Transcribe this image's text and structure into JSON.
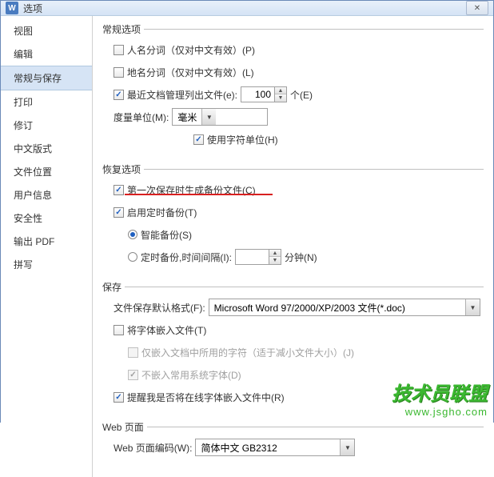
{
  "window": {
    "icon_letter": "W",
    "title": "选项"
  },
  "sidebar": {
    "items": [
      {
        "label": "视图"
      },
      {
        "label": "编辑"
      },
      {
        "label": "常规与保存",
        "selected": true
      },
      {
        "label": "打印"
      },
      {
        "label": "修订"
      },
      {
        "label": "中文版式"
      },
      {
        "label": "文件位置"
      },
      {
        "label": "用户信息"
      },
      {
        "label": "安全性"
      },
      {
        "label": "输出 PDF"
      },
      {
        "label": "拼写"
      }
    ]
  },
  "sections": {
    "general": {
      "legend": "常规选项",
      "name_seg": "人名分词（仅对中文有效）(P)",
      "place_seg": "地名分词（仅对中文有效）(L)",
      "recent_docs_label": "最近文档管理列出文件(e):",
      "recent_docs_value": "100",
      "recent_docs_unit": "个(E)",
      "measure_label": "度量单位(M):",
      "measure_value": "毫米",
      "char_unit": "使用字符单位(H)"
    },
    "recovery": {
      "legend": "恢复选项",
      "first_save_backup": "第一次保存时生成备份文件(C)",
      "enable_timed_backup": "启用定时备份(T)",
      "smart_backup": "智能备份(S)",
      "timed_backup_label": "定时备份,时间间隔(I):",
      "timed_backup_value": "",
      "timed_backup_unit": "分钟(N)"
    },
    "save": {
      "legend": "保存",
      "default_format_label": "文件保存默认格式(F):",
      "default_format_value": "Microsoft Word 97/2000/XP/2003 文件(*.doc)",
      "embed_fonts": "将字体嵌入文件(T)",
      "embed_used_only": "仅嵌入文档中所用的字符（适于减小文件大小）(J)",
      "no_common_fonts": "不嵌入常用系统字体(D)",
      "remind_online_fonts": "提醒我是否将在线字体嵌入文件中(R)"
    },
    "web": {
      "legend": "Web 页面",
      "encoding_label": "Web 页面编码(W):",
      "encoding_value": "简体中文 GB2312"
    }
  },
  "watermark": {
    "text": "技术员联盟",
    "url": "www.jsgho.com"
  }
}
